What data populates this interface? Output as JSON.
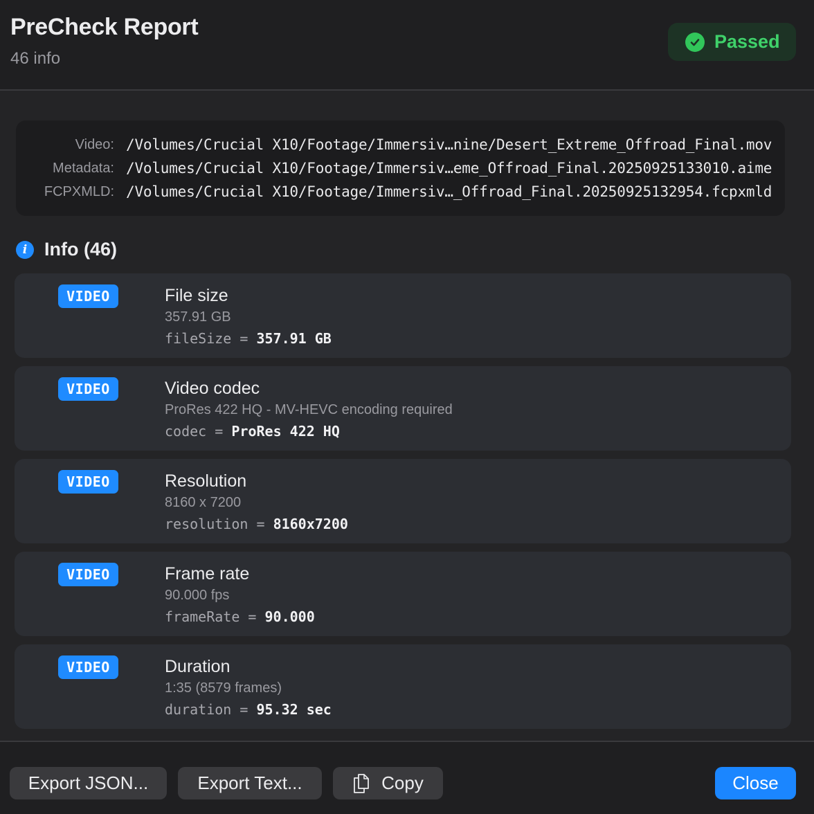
{
  "header": {
    "title": "PreCheck Report",
    "subtitle": "46 info",
    "status": {
      "label": "Passed",
      "icon": "check-circle-icon",
      "color": "#3fd16a"
    }
  },
  "paths": [
    {
      "key": "Video:",
      "value": "/Volumes/Crucial X10/Footage/Immersiv…nine/Desert_Extreme_Offroad_Final.mov"
    },
    {
      "key": "Metadata:",
      "value": "/Volumes/Crucial X10/Footage/Immersiv…eme_Offroad_Final.20250925133010.aime"
    },
    {
      "key": "FCPXMLD:",
      "value": "/Volumes/Crucial X10/Footage/Immersiv…_Offroad_Final.20250925132954.fcpxmld"
    }
  ],
  "section": {
    "icon": "info-icon",
    "title": "Info (46)"
  },
  "items": [
    {
      "badge": "VIDEO",
      "title": "File size",
      "desc": "357.91 GB",
      "key": "fileSize",
      "eq": "=",
      "value": "357.91 GB"
    },
    {
      "badge": "VIDEO",
      "title": "Video codec",
      "desc": "ProRes 422 HQ - MV-HEVC encoding required",
      "key": "codec",
      "eq": "=",
      "value": "ProRes 422 HQ"
    },
    {
      "badge": "VIDEO",
      "title": "Resolution",
      "desc": "8160 x 7200",
      "key": "resolution",
      "eq": "=",
      "value": "8160x7200"
    },
    {
      "badge": "VIDEO",
      "title": "Frame rate",
      "desc": "90.000 fps",
      "key": "frameRate",
      "eq": "=",
      "value": "90.000"
    },
    {
      "badge": "VIDEO",
      "title": "Duration",
      "desc": "1:35 (8579 frames)",
      "key": "duration",
      "eq": "=",
      "value": "95.32 sec"
    }
  ],
  "footer": {
    "export_json": "Export JSON...",
    "export_text": "Export Text...",
    "copy": "Copy",
    "copy_icon": "copy-icon",
    "close": "Close",
    "accent": "#1b86ff"
  }
}
